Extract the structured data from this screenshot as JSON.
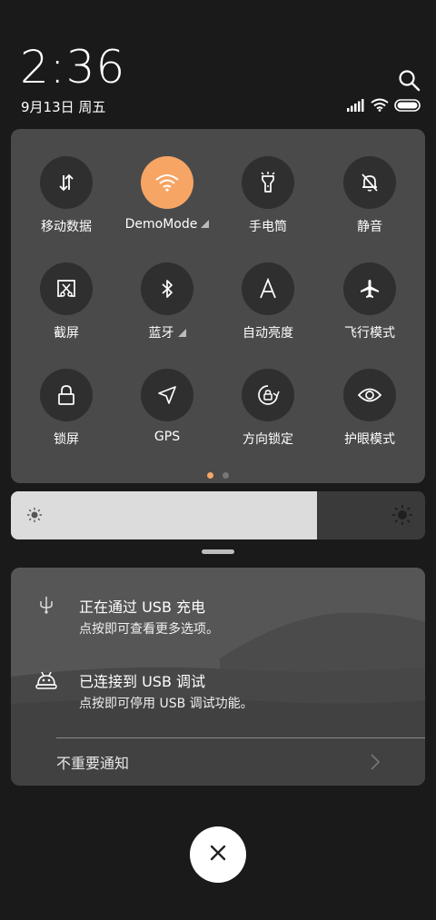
{
  "status": {
    "time": "2:36",
    "date": "9月13日 周五",
    "icons": [
      "search-icon",
      "signal-icon",
      "wifi-icon",
      "battery-icon"
    ]
  },
  "quick_settings": {
    "tiles": [
      {
        "label": "移动数据",
        "icon": "mobile-data-icon",
        "active": false
      },
      {
        "label": "DemoMode",
        "icon": "wifi-icon",
        "active": true,
        "expandable": true
      },
      {
        "label": "手电筒",
        "icon": "flashlight-icon",
        "active": false
      },
      {
        "label": "静音",
        "icon": "mute-bell-icon",
        "active": false
      },
      {
        "label": "截屏",
        "icon": "screenshot-icon",
        "active": false
      },
      {
        "label": "蓝牙",
        "icon": "bluetooth-icon",
        "active": false,
        "expandable": true
      },
      {
        "label": "自动亮度",
        "icon": "auto-brightness-icon",
        "active": false
      },
      {
        "label": "飞行模式",
        "icon": "airplane-icon",
        "active": false
      },
      {
        "label": "锁屏",
        "icon": "lock-icon",
        "active": false
      },
      {
        "label": "GPS",
        "icon": "gps-icon",
        "active": false
      },
      {
        "label": "方向锁定",
        "icon": "rotation-lock-icon",
        "active": false
      },
      {
        "label": "护眼模式",
        "icon": "eye-icon",
        "active": false
      }
    ],
    "page_count": 2,
    "current_page": 1,
    "accent_color": "#f7a565"
  },
  "brightness": {
    "level": 0.74
  },
  "notifications": [
    {
      "title": "正在通过 USB 充电",
      "subtitle": "点按即可查看更多选项。",
      "icon": "usb-icon"
    },
    {
      "title": "已连接到 USB 调试",
      "subtitle": "点按即可停用 USB 调试功能。",
      "icon": "android-debug-icon"
    }
  ],
  "less_important_label": "不重要通知",
  "close_icon": "close-icon"
}
